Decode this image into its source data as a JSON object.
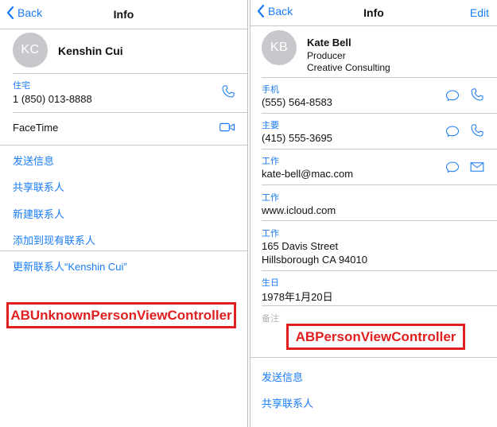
{
  "left": {
    "nav": {
      "back": "Back",
      "title": "Info"
    },
    "contact": {
      "initials": "KC",
      "name": "Kenshin Cui"
    },
    "phone": {
      "label": "住宅",
      "value": "1 (850) 013-8888"
    },
    "facetime": {
      "label": "FaceTime"
    },
    "actions": [
      "发送信息",
      "共享联系人",
      "新建联系人",
      "添加到现有联系人",
      "更新联系人“Kenshin Cui”"
    ],
    "caption": "ABUnknownPersonViewController"
  },
  "right": {
    "nav": {
      "back": "Back",
      "title": "Info",
      "edit": "Edit"
    },
    "contact": {
      "initials": "KB",
      "name": "Kate Bell",
      "title": "Producer",
      "company": "Creative Consulting"
    },
    "fields": [
      {
        "label": "手机",
        "value": "(555) 564-8583"
      },
      {
        "label": "主要",
        "value": "(415) 555-3695"
      },
      {
        "label": "工作",
        "value": "kate-bell@mac.com"
      },
      {
        "label": "工作",
        "value": "www.icloud.com"
      },
      {
        "label": "工作",
        "line1": "165 Davis Street",
        "line2": "Hillsborough CA 94010"
      },
      {
        "label": "生日",
        "value": "1978年1月20日"
      }
    ],
    "notes_label": "备注",
    "actions": [
      "发送信息",
      "共享联系人"
    ],
    "caption": "ABPersonViewController"
  },
  "colors": {
    "accent": "#1a7cf5",
    "caption": "#e02020",
    "avatar": "#c6c8cc"
  },
  "icons": [
    "chevron-left-icon",
    "phone-icon",
    "video-icon",
    "message-icon",
    "mail-icon"
  ]
}
